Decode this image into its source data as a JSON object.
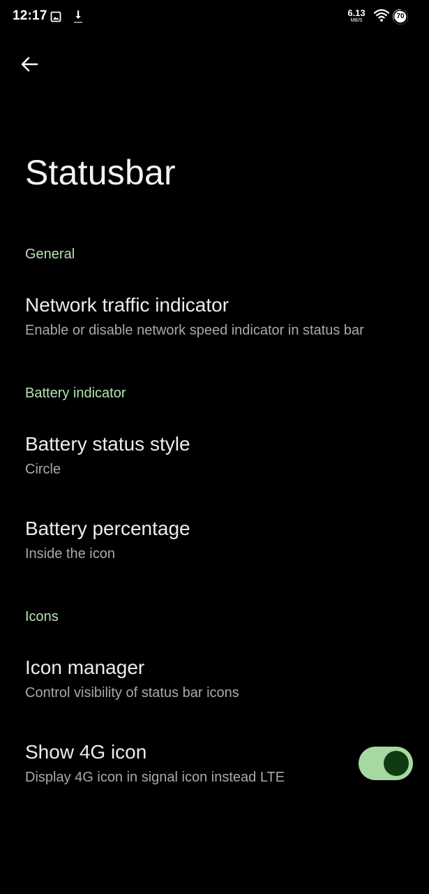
{
  "status_bar": {
    "time": "12:17",
    "net_speed_value": "6.13",
    "net_speed_unit": "MB/S",
    "battery_level": "70",
    "icons": [
      "gallery-icon",
      "download-icon",
      "wifi-icon",
      "battery-circle-icon"
    ]
  },
  "header": {
    "back_icon": "arrow-left-icon",
    "title": "Statusbar"
  },
  "sections": [
    {
      "header": "General",
      "items": [
        {
          "title": "Network traffic indicator",
          "summary": "Enable or disable network speed indicator in status bar"
        }
      ]
    },
    {
      "header": "Battery indicator",
      "items": [
        {
          "title": "Battery status style",
          "summary": "Circle"
        },
        {
          "title": "Battery percentage",
          "summary": "Inside the icon"
        }
      ]
    },
    {
      "header": "Icons",
      "items": [
        {
          "title": "Icon manager",
          "summary": "Control visibility of status bar icons"
        },
        {
          "title": "Show 4G icon",
          "summary": "Display 4G icon in signal icon instead LTE",
          "toggle_on": true
        }
      ]
    }
  ],
  "colors": {
    "background": "#000000",
    "accent": "#b7e3b4",
    "toggle_track": "#a6d9a1",
    "toggle_thumb": "#0f3b12"
  }
}
